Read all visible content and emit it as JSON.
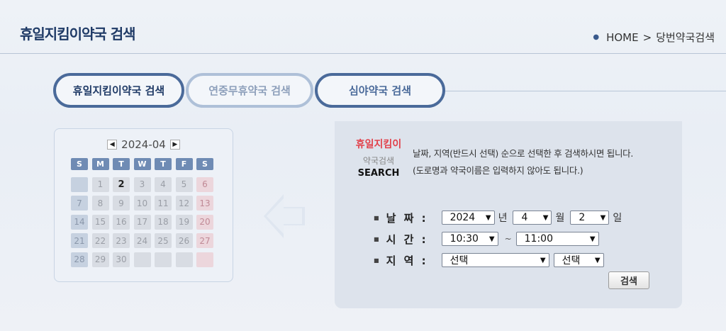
{
  "header": {
    "title": "휴일지킴이약국 검색",
    "breadcrumb": {
      "home": "HOME",
      "separator": ">",
      "current": "당번약국검색"
    }
  },
  "tabs": [
    {
      "label": "휴일지킴이약국 검색",
      "active": true
    },
    {
      "label": "연중무휴약국 검색",
      "active": false
    },
    {
      "label": "심야약국 검색",
      "active": false
    }
  ],
  "calendar": {
    "month_label": "2024-04",
    "prev_label": "<",
    "next_label": ">",
    "weekdays": [
      "S",
      "M",
      "T",
      "W",
      "T",
      "F",
      "S"
    ],
    "weeks": [
      [
        "",
        "1",
        "2",
        "3",
        "4",
        "5",
        "6"
      ],
      [
        "7",
        "8",
        "9",
        "10",
        "11",
        "12",
        "13"
      ],
      [
        "14",
        "15",
        "16",
        "17",
        "18",
        "19",
        "20"
      ],
      [
        "21",
        "22",
        "23",
        "24",
        "25",
        "26",
        "27"
      ],
      [
        "28",
        "29",
        "30",
        "",
        "",
        "",
        ""
      ]
    ],
    "today": "2"
  },
  "search": {
    "label_red": "휴일지킴이",
    "label_gray": "약국검색",
    "label_search": "SEARCH",
    "desc_line1": "날짜, 지역(반드시 선택) 순으로 선택한 후 검색하시면 됩니다.",
    "desc_line2": "(도로명과 약국이름은 입력하지 않아도 됩니다.)",
    "date": {
      "label": "날 짜 :",
      "year": "2024",
      "year_unit": "년",
      "month": "4",
      "month_unit": "월",
      "day": "2",
      "day_unit": "일"
    },
    "time": {
      "label": "시 간 :",
      "start": "10:30",
      "separator": "~",
      "end": "11:00"
    },
    "region": {
      "label": "지 역 :",
      "city": "선택",
      "district": "선택"
    },
    "button_label": "검색"
  }
}
